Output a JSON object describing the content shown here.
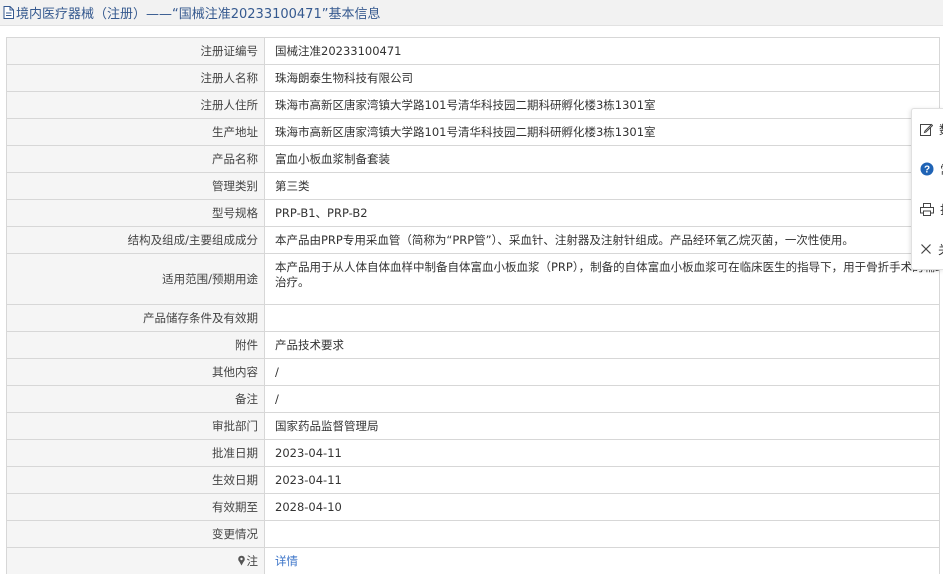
{
  "header": {
    "title": "境内医疗器械（注册）——“国械注准20233100471”基本信息"
  },
  "rows": [
    {
      "label": "注册证编号",
      "value": "国械注准20233100471"
    },
    {
      "label": "注册人名称",
      "value": "珠海朗泰生物科技有限公司"
    },
    {
      "label": "注册人住所",
      "value": "珠海市高新区唐家湾镇大学路101号清华科技园二期科研孵化楼3栋1301室"
    },
    {
      "label": "生产地址",
      "value": "珠海市高新区唐家湾镇大学路101号清华科技园二期科研孵化楼3栋1301室"
    },
    {
      "label": "产品名称",
      "value": "富血小板血浆制备套装"
    },
    {
      "label": "管理类别",
      "value": "第三类"
    },
    {
      "label": "型号规格",
      "value": "PRP-B1、PRP-B2"
    },
    {
      "label": "结构及组成/主要组成成分",
      "value": "本产品由PRP专用采血管（简称为“PRP管”）、采血针、注射器及注射针组成。产品经环氧乙烷灭菌，一次性使用。"
    },
    {
      "label": "适用范围/预期用途",
      "value_line1": "本产品用于从人体自体血样中制备自体富血小板血浆（PRP），制备的自体富血小板血浆可在临床医生的指导下，用于骨折手术的辅助",
      "value_line2": "治疗。"
    },
    {
      "label": "产品储存条件及有效期",
      "value": ""
    },
    {
      "label": "附件",
      "value": "产品技术要求"
    },
    {
      "label": "其他内容",
      "value": "/"
    },
    {
      "label": "备注",
      "value": "/"
    },
    {
      "label": "审批部门",
      "value": "国家药品监督管理局"
    },
    {
      "label": "批准日期",
      "value": "2023-04-11"
    },
    {
      "label": "生效日期",
      "value": "2023-04-11"
    },
    {
      "label": "有效期至",
      "value": "2028-04-10"
    },
    {
      "label": "变更情况",
      "value": ""
    },
    {
      "label": "注",
      "value": "详情"
    }
  ],
  "side_panel": {
    "items": [
      {
        "label": "数",
        "icon": "edit-icon"
      },
      {
        "label": "常",
        "icon": "help-icon"
      },
      {
        "label": "打",
        "icon": "print-icon"
      },
      {
        "label": "关",
        "icon": "close-icon"
      }
    ]
  },
  "colors": {
    "header_text": "#35598f",
    "link": "#3a73c8",
    "label_bg": "#f5f5f5",
    "border": "#d7d7d7",
    "help_icon": "#1f63b5"
  }
}
